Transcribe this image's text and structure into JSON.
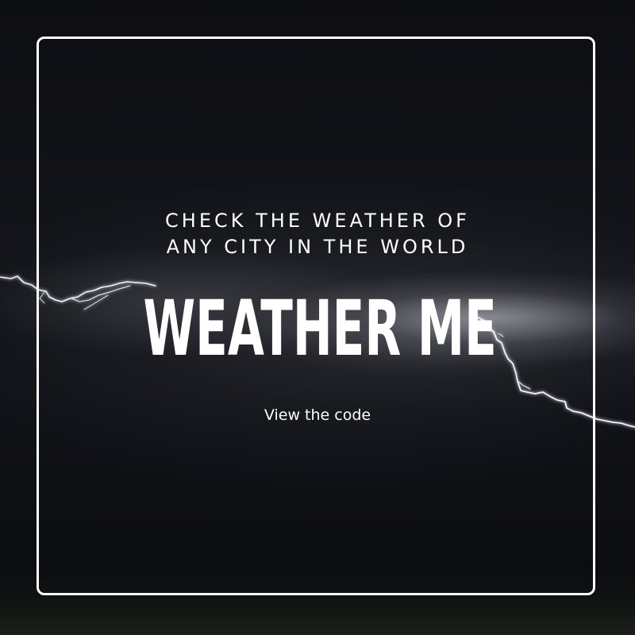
{
  "tagline": {
    "line1": "CHECK THE WEATHER OF",
    "line2": "ANY CITY IN THE WORLD"
  },
  "title": "WEATHER ME",
  "link": {
    "label": "View the code"
  },
  "colors": {
    "background": "#0c0d11",
    "text": "#ffffff",
    "frame": "#ffffff",
    "lightning": "#f4f2ff"
  }
}
